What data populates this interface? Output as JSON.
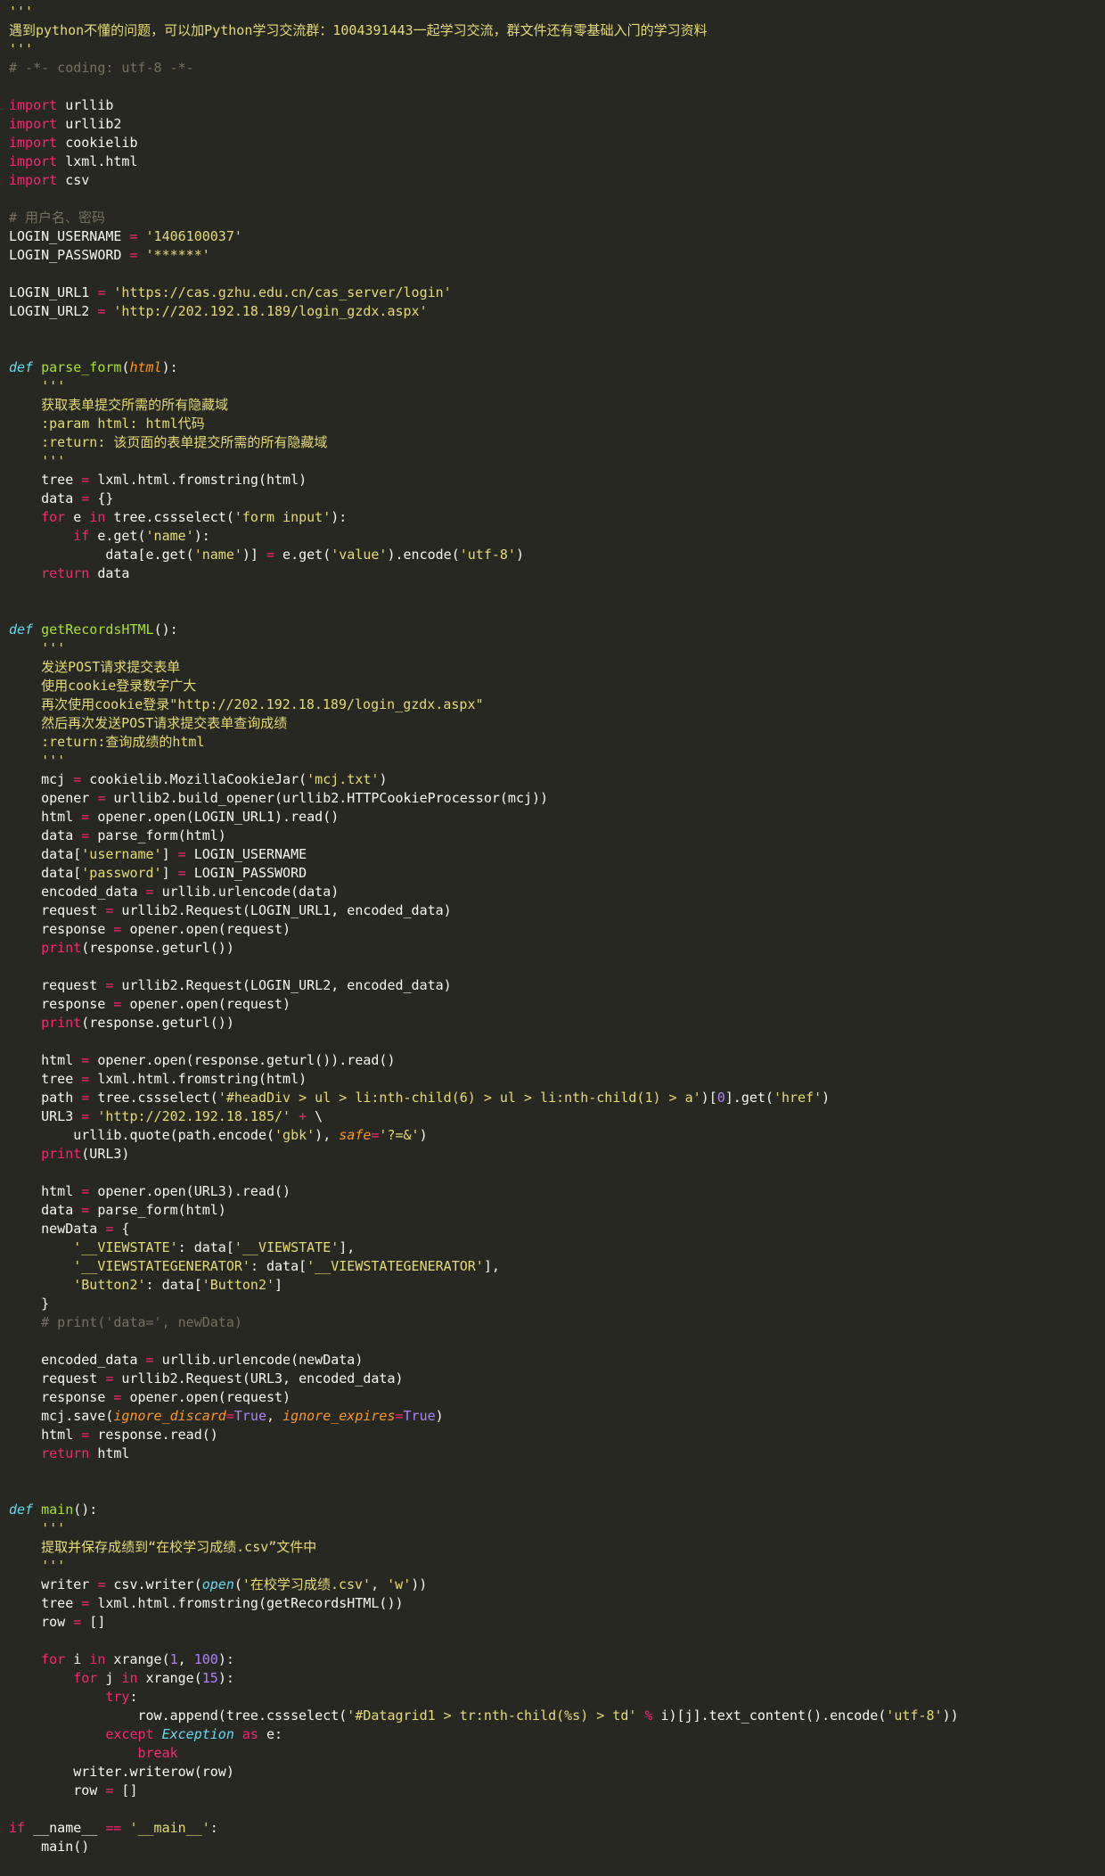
{
  "editor": {
    "theme_colors": {
      "background": "#272822",
      "plain": "#f8f8f2",
      "keyword": "#f92672",
      "function_name": "#a6e22e",
      "string": "#e6db74",
      "comment": "#75715e",
      "number": "#ae81ff",
      "parameter": "#fd971f",
      "builtin": "#66d9ef"
    },
    "lines": [
      [
        [
          "string",
          "'''"
        ]
      ],
      [
        [
          "string",
          "遇到python不懂的问题，可以加Python学习交流群：1004391443一起学习交流，群文件还有零基础入门的学习资料"
        ]
      ],
      [
        [
          "string",
          "'''"
        ]
      ],
      [
        [
          "comment",
          "# -*- coding: utf-8 -*-"
        ]
      ],
      [],
      [
        [
          "keyword",
          "import"
        ],
        [
          "plain",
          " urllib"
        ]
      ],
      [
        [
          "keyword",
          "import"
        ],
        [
          "plain",
          " urllib2"
        ]
      ],
      [
        [
          "keyword",
          "import"
        ],
        [
          "plain",
          " cookielib"
        ]
      ],
      [
        [
          "keyword",
          "import"
        ],
        [
          "plain",
          " lxml.html"
        ]
      ],
      [
        [
          "keyword",
          "import"
        ],
        [
          "plain",
          " csv"
        ]
      ],
      [],
      [
        [
          "comment",
          "# 用户名、密码"
        ]
      ],
      [
        [
          "plain",
          "LOGIN_USERNAME "
        ],
        [
          "operator",
          "="
        ],
        [
          "plain",
          " "
        ],
        [
          "string",
          "'1406100037'"
        ]
      ],
      [
        [
          "plain",
          "LOGIN_PASSWORD "
        ],
        [
          "operator",
          "="
        ],
        [
          "plain",
          " "
        ],
        [
          "string",
          "'******'"
        ]
      ],
      [],
      [
        [
          "plain",
          "LOGIN_URL1 "
        ],
        [
          "operator",
          "="
        ],
        [
          "plain",
          " "
        ],
        [
          "string",
          "'https://cas.gzhu.edu.cn/cas_server/login'"
        ]
      ],
      [
        [
          "plain",
          "LOGIN_URL2 "
        ],
        [
          "operator",
          "="
        ],
        [
          "plain",
          " "
        ],
        [
          "string",
          "'http://202.192.18.189/login_gzdx.aspx'"
        ]
      ],
      [],
      [],
      [
        [
          "def",
          "def"
        ],
        [
          "plain",
          " "
        ],
        [
          "funcname",
          "parse_form"
        ],
        [
          "plain",
          "("
        ],
        [
          "param",
          "html"
        ],
        [
          "plain",
          "):"
        ]
      ],
      [
        [
          "string",
          "    '''"
        ]
      ],
      [
        [
          "string",
          "    获取表单提交所需的所有隐藏域"
        ]
      ],
      [
        [
          "string",
          "    :param html: html代码"
        ]
      ],
      [
        [
          "string",
          "    :return: 该页面的表单提交所需的所有隐藏域"
        ]
      ],
      [
        [
          "string",
          "    '''"
        ]
      ],
      [
        [
          "plain",
          "    tree "
        ],
        [
          "operator",
          "="
        ],
        [
          "plain",
          " lxml.html.fromstring(html)"
        ]
      ],
      [
        [
          "plain",
          "    data "
        ],
        [
          "operator",
          "="
        ],
        [
          "plain",
          " {}"
        ]
      ],
      [
        [
          "keyword",
          "    for"
        ],
        [
          "plain",
          " e "
        ],
        [
          "keyword",
          "in"
        ],
        [
          "plain",
          " tree.cssselect("
        ],
        [
          "string",
          "'form input'"
        ],
        [
          "plain",
          "):"
        ]
      ],
      [
        [
          "keyword",
          "        if"
        ],
        [
          "plain",
          " e.get("
        ],
        [
          "string",
          "'name'"
        ],
        [
          "plain",
          "):"
        ]
      ],
      [
        [
          "plain",
          "            data[e.get("
        ],
        [
          "string",
          "'name'"
        ],
        [
          "plain",
          ")] "
        ],
        [
          "operator",
          "="
        ],
        [
          "plain",
          " e.get("
        ],
        [
          "string",
          "'value'"
        ],
        [
          "plain",
          ").encode("
        ],
        [
          "string",
          "'utf-8'"
        ],
        [
          "plain",
          ")"
        ]
      ],
      [
        [
          "keyword",
          "    return"
        ],
        [
          "plain",
          " data"
        ]
      ],
      [],
      [],
      [
        [
          "def",
          "def"
        ],
        [
          "plain",
          " "
        ],
        [
          "funcname",
          "getRecordsHTML"
        ],
        [
          "plain",
          "():"
        ]
      ],
      [
        [
          "string",
          "    '''"
        ]
      ],
      [
        [
          "string",
          "    发送POST请求提交表单"
        ]
      ],
      [
        [
          "string",
          "    使用cookie登录数字广大"
        ]
      ],
      [
        [
          "string",
          "    再次使用cookie登录\"http://202.192.18.189/login_gzdx.aspx\""
        ]
      ],
      [
        [
          "string",
          "    然后再次发送POST请求提交表单查询成绩"
        ]
      ],
      [
        [
          "string",
          "    :return:查询成绩的html"
        ]
      ],
      [
        [
          "string",
          "    '''"
        ]
      ],
      [
        [
          "plain",
          "    mcj "
        ],
        [
          "operator",
          "="
        ],
        [
          "plain",
          " cookielib.MozillaCookieJar("
        ],
        [
          "string",
          "'mcj.txt'"
        ],
        [
          "plain",
          ")"
        ]
      ],
      [
        [
          "plain",
          "    opener "
        ],
        [
          "operator",
          "="
        ],
        [
          "plain",
          " urllib2.build_opener(urllib2.HTTPCookieProcessor(mcj))"
        ]
      ],
      [
        [
          "plain",
          "    html "
        ],
        [
          "operator",
          "="
        ],
        [
          "plain",
          " opener.open(LOGIN_URL1).read()"
        ]
      ],
      [
        [
          "plain",
          "    data "
        ],
        [
          "operator",
          "="
        ],
        [
          "plain",
          " parse_form(html)"
        ]
      ],
      [
        [
          "plain",
          "    data["
        ],
        [
          "string",
          "'username'"
        ],
        [
          "plain",
          "] "
        ],
        [
          "operator",
          "="
        ],
        [
          "plain",
          " LOGIN_USERNAME"
        ]
      ],
      [
        [
          "plain",
          "    data["
        ],
        [
          "string",
          "'password'"
        ],
        [
          "plain",
          "] "
        ],
        [
          "operator",
          "="
        ],
        [
          "plain",
          " LOGIN_PASSWORD"
        ]
      ],
      [
        [
          "plain",
          "    encoded_data "
        ],
        [
          "operator",
          "="
        ],
        [
          "plain",
          " urllib.urlencode(data)"
        ]
      ],
      [
        [
          "plain",
          "    request "
        ],
        [
          "operator",
          "="
        ],
        [
          "plain",
          " urllib2.Request(LOGIN_URL1, encoded_data)"
        ]
      ],
      [
        [
          "plain",
          "    response "
        ],
        [
          "operator",
          "="
        ],
        [
          "plain",
          " opener.open(request)"
        ]
      ],
      [
        [
          "plain",
          "    "
        ],
        [
          "keyword",
          "print"
        ],
        [
          "plain",
          "(response.geturl())"
        ]
      ],
      [],
      [
        [
          "plain",
          "    request "
        ],
        [
          "operator",
          "="
        ],
        [
          "plain",
          " urllib2.Request(LOGIN_URL2, encoded_data)"
        ]
      ],
      [
        [
          "plain",
          "    response "
        ],
        [
          "operator",
          "="
        ],
        [
          "plain",
          " opener.open(request)"
        ]
      ],
      [
        [
          "plain",
          "    "
        ],
        [
          "keyword",
          "print"
        ],
        [
          "plain",
          "(response.geturl())"
        ]
      ],
      [],
      [
        [
          "plain",
          "    html "
        ],
        [
          "operator",
          "="
        ],
        [
          "plain",
          " opener.open(response.geturl()).read()"
        ]
      ],
      [
        [
          "plain",
          "    tree "
        ],
        [
          "operator",
          "="
        ],
        [
          "plain",
          " lxml.html.fromstring(html)"
        ]
      ],
      [
        [
          "plain",
          "    path "
        ],
        [
          "operator",
          "="
        ],
        [
          "plain",
          " tree.cssselect("
        ],
        [
          "string",
          "'#headDiv > ul > li:nth-child(6) > ul > li:nth-child(1) > a'"
        ],
        [
          "plain",
          ")["
        ],
        [
          "number",
          "0"
        ],
        [
          "plain",
          "].get("
        ],
        [
          "string",
          "'href'"
        ],
        [
          "plain",
          ")"
        ]
      ],
      [
        [
          "plain",
          "    URL3 "
        ],
        [
          "operator",
          "="
        ],
        [
          "plain",
          " "
        ],
        [
          "string",
          "'http://202.192.18.185/'"
        ],
        [
          "plain",
          " "
        ],
        [
          "operator",
          "+"
        ],
        [
          "plain",
          " \\"
        ]
      ],
      [
        [
          "plain",
          "        urllib.quote(path.encode("
        ],
        [
          "string",
          "'gbk'"
        ],
        [
          "plain",
          "), "
        ],
        [
          "param",
          "safe"
        ],
        [
          "operator",
          "="
        ],
        [
          "string",
          "'?=&'"
        ],
        [
          "plain",
          ")"
        ]
      ],
      [
        [
          "plain",
          "    "
        ],
        [
          "keyword",
          "print"
        ],
        [
          "plain",
          "(URL3)"
        ]
      ],
      [],
      [
        [
          "plain",
          "    html "
        ],
        [
          "operator",
          "="
        ],
        [
          "plain",
          " opener.open(URL3).read()"
        ]
      ],
      [
        [
          "plain",
          "    data "
        ],
        [
          "operator",
          "="
        ],
        [
          "plain",
          " parse_form(html)"
        ]
      ],
      [
        [
          "plain",
          "    newData "
        ],
        [
          "operator",
          "="
        ],
        [
          "plain",
          " {"
        ]
      ],
      [
        [
          "string",
          "        '__VIEWSTATE'"
        ],
        [
          "plain",
          ": data["
        ],
        [
          "string",
          "'__VIEWSTATE'"
        ],
        [
          "plain",
          "],"
        ]
      ],
      [
        [
          "string",
          "        '__VIEWSTATEGENERATOR'"
        ],
        [
          "plain",
          ": data["
        ],
        [
          "string",
          "'__VIEWSTATEGENERATOR'"
        ],
        [
          "plain",
          "],"
        ]
      ],
      [
        [
          "string",
          "        'Button2'"
        ],
        [
          "plain",
          ": data["
        ],
        [
          "string",
          "'Button2'"
        ],
        [
          "plain",
          "]"
        ]
      ],
      [
        [
          "plain",
          "    }"
        ]
      ],
      [
        [
          "comment",
          "    # print('data=', newData)"
        ]
      ],
      [],
      [
        [
          "plain",
          "    encoded_data "
        ],
        [
          "operator",
          "="
        ],
        [
          "plain",
          " urllib.urlencode(newData)"
        ]
      ],
      [
        [
          "plain",
          "    request "
        ],
        [
          "operator",
          "="
        ],
        [
          "plain",
          " urllib2.Request(URL3, encoded_data)"
        ]
      ],
      [
        [
          "plain",
          "    response "
        ],
        [
          "operator",
          "="
        ],
        [
          "plain",
          " opener.open(request)"
        ]
      ],
      [
        [
          "plain",
          "    mcj.save("
        ],
        [
          "param",
          "ignore_discard"
        ],
        [
          "operator",
          "="
        ],
        [
          "constant",
          "True"
        ],
        [
          "plain",
          ", "
        ],
        [
          "param",
          "ignore_expires"
        ],
        [
          "operator",
          "="
        ],
        [
          "constant",
          "True"
        ],
        [
          "plain",
          ")"
        ]
      ],
      [
        [
          "plain",
          "    html "
        ],
        [
          "operator",
          "="
        ],
        [
          "plain",
          " response.read()"
        ]
      ],
      [
        [
          "keyword",
          "    return"
        ],
        [
          "plain",
          " html"
        ]
      ],
      [],
      [],
      [
        [
          "def",
          "def"
        ],
        [
          "plain",
          " "
        ],
        [
          "funcname",
          "main"
        ],
        [
          "plain",
          "():"
        ]
      ],
      [
        [
          "string",
          "    '''"
        ]
      ],
      [
        [
          "string",
          "    提取并保存成绩到“在校学习成绩.csv”文件中"
        ]
      ],
      [
        [
          "string",
          "    '''"
        ]
      ],
      [
        [
          "plain",
          "    writer "
        ],
        [
          "operator",
          "="
        ],
        [
          "plain",
          " csv.writer("
        ],
        [
          "builtin",
          "open"
        ],
        [
          "plain",
          "("
        ],
        [
          "string",
          "'在校学习成绩.csv'"
        ],
        [
          "plain",
          ", "
        ],
        [
          "string",
          "'w'"
        ],
        [
          "plain",
          "))"
        ]
      ],
      [
        [
          "plain",
          "    tree "
        ],
        [
          "operator",
          "="
        ],
        [
          "plain",
          " lxml.html.fromstring(getRecordsHTML())"
        ]
      ],
      [
        [
          "plain",
          "    row "
        ],
        [
          "operator",
          "="
        ],
        [
          "plain",
          " []"
        ]
      ],
      [],
      [
        [
          "keyword",
          "    for"
        ],
        [
          "plain",
          " i "
        ],
        [
          "keyword",
          "in"
        ],
        [
          "plain",
          " xrange("
        ],
        [
          "number",
          "1"
        ],
        [
          "plain",
          ", "
        ],
        [
          "number",
          "100"
        ],
        [
          "plain",
          "):"
        ]
      ],
      [
        [
          "keyword",
          "        for"
        ],
        [
          "plain",
          " j "
        ],
        [
          "keyword",
          "in"
        ],
        [
          "plain",
          " xrange("
        ],
        [
          "number",
          "15"
        ],
        [
          "plain",
          "):"
        ]
      ],
      [
        [
          "keyword",
          "            try"
        ],
        [
          "plain",
          ":"
        ]
      ],
      [
        [
          "plain",
          "                row.append(tree.cssselect("
        ],
        [
          "string",
          "'#Datagrid1 > tr:nth-child(%s) > td'"
        ],
        [
          "plain",
          " "
        ],
        [
          "operator",
          "%"
        ],
        [
          "plain",
          " i)[j].text_content().encode("
        ],
        [
          "string",
          "'utf-8'"
        ],
        [
          "plain",
          "))"
        ]
      ],
      [
        [
          "keyword",
          "            except"
        ],
        [
          "plain",
          " "
        ],
        [
          "exception",
          "Exception"
        ],
        [
          "plain",
          " "
        ],
        [
          "keyword",
          "as"
        ],
        [
          "plain",
          " e:"
        ]
      ],
      [
        [
          "keyword",
          "                break"
        ]
      ],
      [
        [
          "plain",
          "        writer.writerow(row)"
        ]
      ],
      [
        [
          "plain",
          "        row "
        ],
        [
          "operator",
          "="
        ],
        [
          "plain",
          " []"
        ]
      ],
      [],
      [
        [
          "keyword",
          "if"
        ],
        [
          "plain",
          " __name__ "
        ],
        [
          "operator",
          "=="
        ],
        [
          "plain",
          " "
        ],
        [
          "string",
          "'__main__'"
        ],
        [
          "plain",
          ":"
        ]
      ],
      [
        [
          "plain",
          "    main()"
        ]
      ]
    ]
  }
}
